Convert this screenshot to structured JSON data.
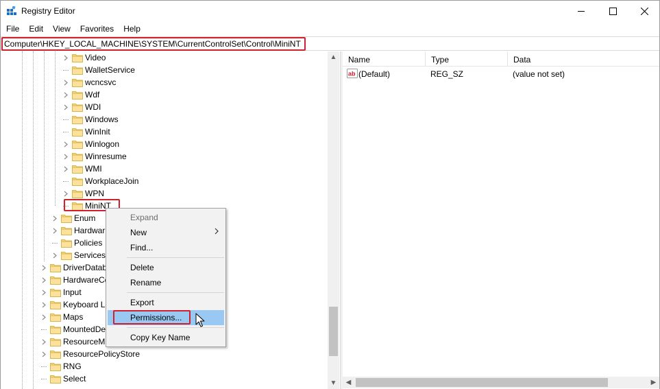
{
  "window": {
    "title": "Registry Editor"
  },
  "menu": [
    "File",
    "Edit",
    "View",
    "Favorites",
    "Help"
  ],
  "address": "Computer\\HKEY_LOCAL_MACHINE\\SYSTEM\\CurrentControlSet\\Control\\MiniNT",
  "tree": [
    {
      "label": "Video",
      "level": 3,
      "expandable": true
    },
    {
      "label": "WalletService",
      "level": 3,
      "expandable": false
    },
    {
      "label": "wcncsvc",
      "level": 3,
      "expandable": true
    },
    {
      "label": "Wdf",
      "level": 3,
      "expandable": true
    },
    {
      "label": "WDI",
      "level": 3,
      "expandable": true
    },
    {
      "label": "Windows",
      "level": 3,
      "expandable": false
    },
    {
      "label": "WinInit",
      "level": 3,
      "expandable": false
    },
    {
      "label": "Winlogon",
      "level": 3,
      "expandable": true
    },
    {
      "label": "Winresume",
      "level": 3,
      "expandable": true
    },
    {
      "label": "WMI",
      "level": 3,
      "expandable": true
    },
    {
      "label": "WorkplaceJoin",
      "level": 3,
      "expandable": false
    },
    {
      "label": "WPN",
      "level": 3,
      "expandable": true
    },
    {
      "label": "MiniNT",
      "level": 3,
      "expandable": false,
      "selected": true
    },
    {
      "label": "Enum",
      "level": 2,
      "expandable": true
    },
    {
      "label": "Hardwar",
      "level": 2,
      "expandable": true
    },
    {
      "label": "Policies",
      "level": 2,
      "expandable": false
    },
    {
      "label": "Services",
      "level": 2,
      "expandable": true
    },
    {
      "label": "DriverDatab",
      "level": 1,
      "expandable": true
    },
    {
      "label": "HardwareCo",
      "level": 1,
      "expandable": true
    },
    {
      "label": "Input",
      "level": 1,
      "expandable": true
    },
    {
      "label": "Keyboard La",
      "level": 1,
      "expandable": true
    },
    {
      "label": "Maps",
      "level": 1,
      "expandable": true
    },
    {
      "label": "MountedDe",
      "level": 1,
      "expandable": false
    },
    {
      "label": "ResourceMa",
      "level": 1,
      "expandable": true
    },
    {
      "label": "ResourcePolicyStore",
      "level": 1,
      "expandable": true
    },
    {
      "label": "RNG",
      "level": 1,
      "expandable": false
    },
    {
      "label": "Select",
      "level": 1,
      "expandable": false
    }
  ],
  "columns": [
    "Name",
    "Type",
    "Data"
  ],
  "values": [
    {
      "name": "(Default)",
      "type": "REG_SZ",
      "data": "(value not set)"
    }
  ],
  "context_menu": [
    {
      "label": "Expand",
      "disabled": true
    },
    {
      "label": "New",
      "submenu": true
    },
    {
      "label": "Find..."
    },
    {
      "separator": true
    },
    {
      "label": "Delete"
    },
    {
      "label": "Rename"
    },
    {
      "separator": true
    },
    {
      "label": "Export"
    },
    {
      "label": "Permissions...",
      "selected": true
    },
    {
      "separator": true
    },
    {
      "label": "Copy Key Name"
    }
  ],
  "scroll": {
    "tree_vertical_position": 0.92
  },
  "colors": {
    "highlight_border": "#d0202e",
    "menu_selection": "#99c9f3",
    "folder": "#f8d775"
  },
  "icons": {
    "app": "registry-editor-icon",
    "folder": "folder-icon",
    "value_string": "string-value-icon",
    "expand": "chevron-right-icon",
    "submenu": "chevron-right-icon",
    "cursor": "mouse-pointer-icon"
  }
}
